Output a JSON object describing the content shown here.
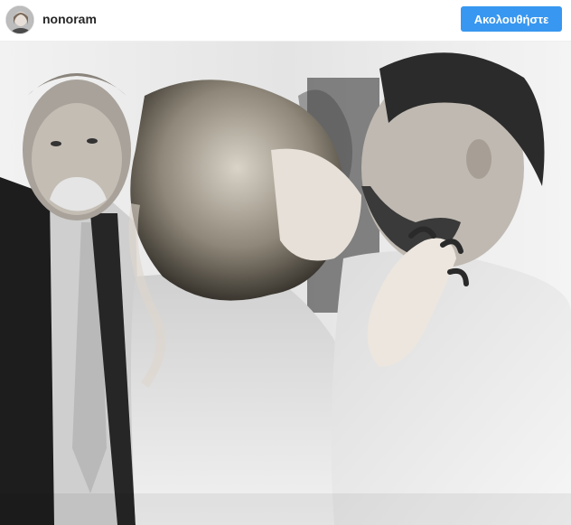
{
  "post": {
    "username": "nonoram",
    "follow_label": "Ακολουθήστε",
    "avatar_icon": "user-avatar-icon",
    "photo_description_icon": "photo-image"
  },
  "colors": {
    "follow_button": "#3897f0",
    "username_text": "#262626"
  }
}
